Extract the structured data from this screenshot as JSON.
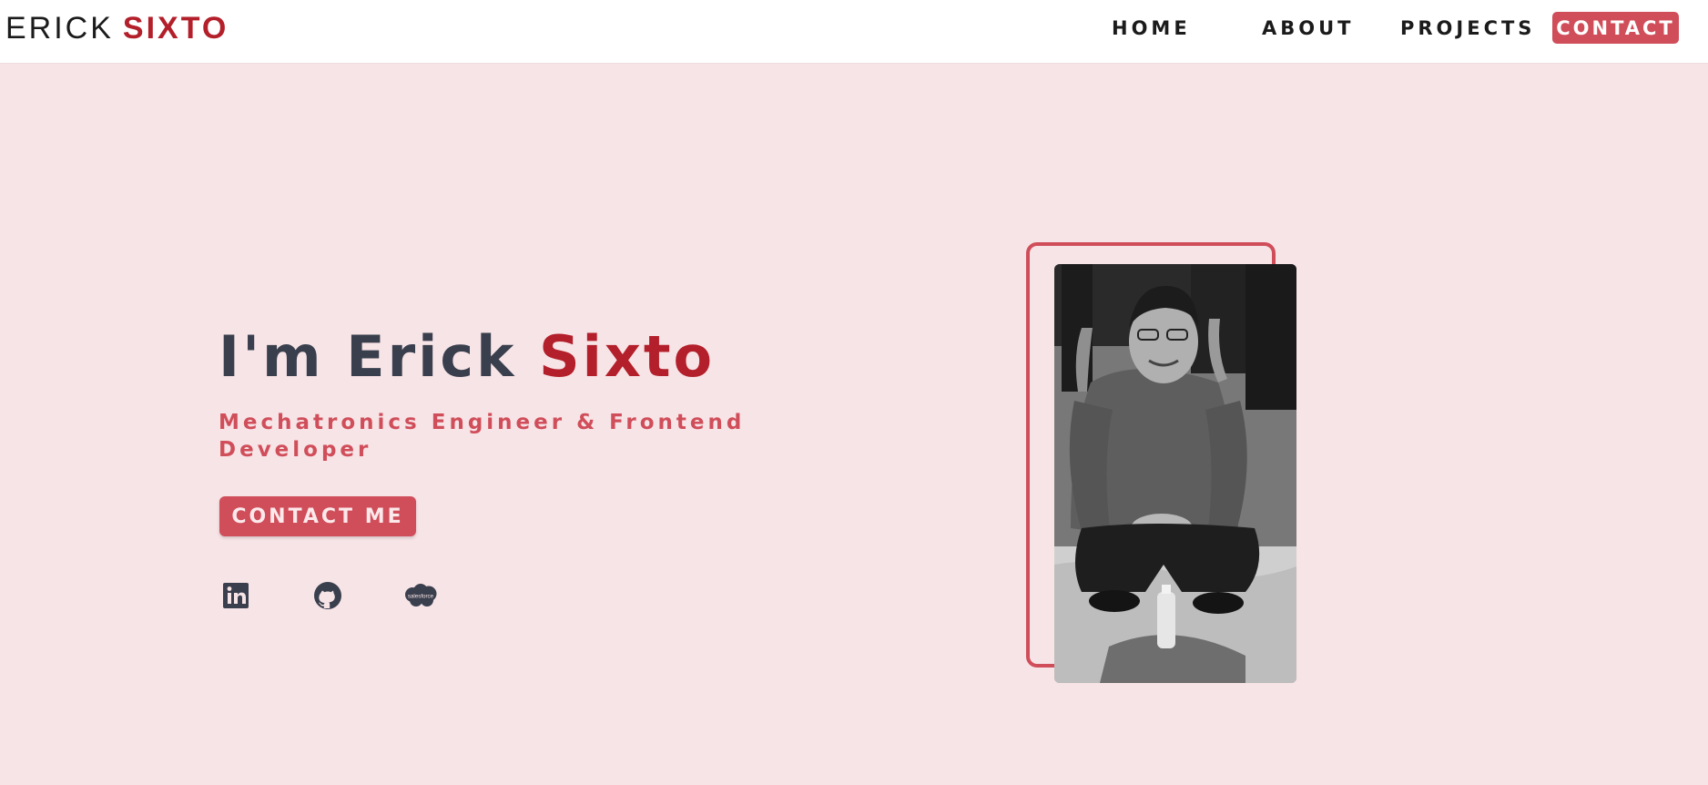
{
  "brand": {
    "first": "ERICK",
    "last": "SIXTO"
  },
  "nav": {
    "items": [
      "HOME",
      "ABOUT",
      "PROJECTS"
    ],
    "contact": "CONTACT"
  },
  "hero": {
    "greeting": "I'm Erick",
    "surname": "Sixto",
    "subtitle": "Mechatronics Engineer & Frontend Developer",
    "cta": "CONTACT ME"
  },
  "social": {
    "icons": [
      "linkedin-icon",
      "github-icon",
      "salesforce-icon"
    ],
    "salesforce_logo_text": "salesforce"
  },
  "photo": {
    "alt": "Erick Sixto"
  },
  "colors": {
    "background": "#f7e4e7",
    "accent": "#d04e5a",
    "dark_red": "#b31f2a",
    "text_dark": "#3a3f4d",
    "nav_bg": "#ffffff"
  }
}
